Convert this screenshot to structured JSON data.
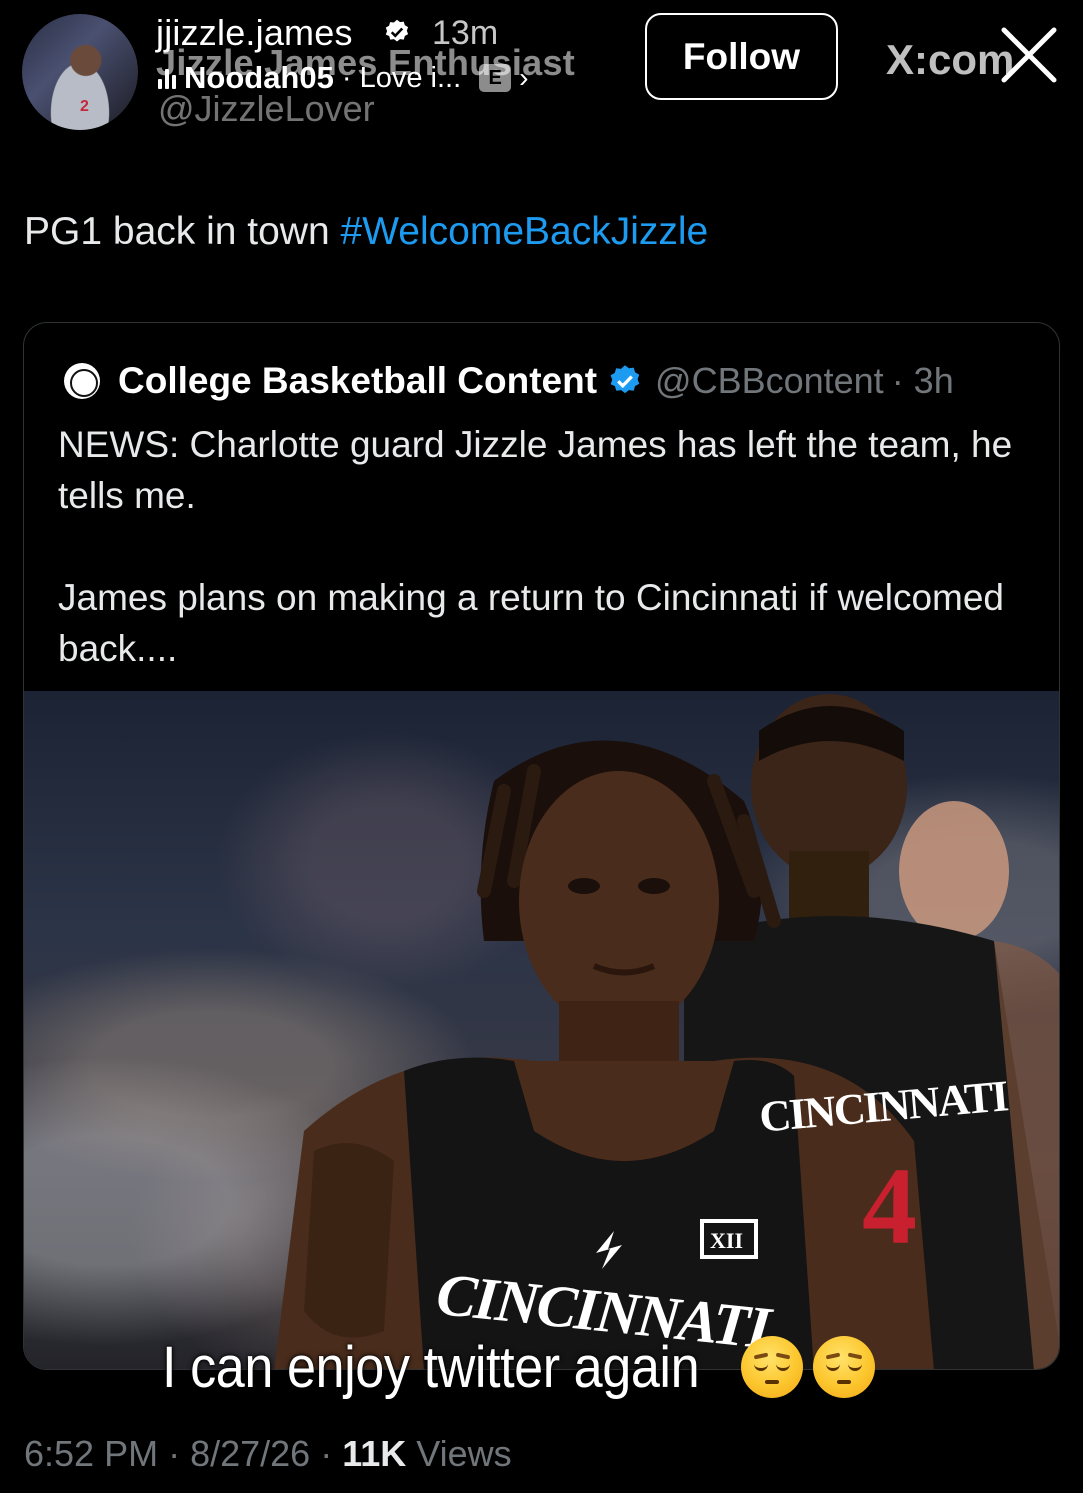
{
  "story": {
    "username": "jjizzle.james",
    "time_ago": "13m",
    "display_name_overlay": "Jizzle James Enthusiast",
    "music": {
      "artist": "Noodah05",
      "track": "· Love i...",
      "badge": "E"
    },
    "follow_label": "Follow",
    "source_label": "X:com"
  },
  "tweet": {
    "handle": "@JizzleLover",
    "text": "PG1 back in town ",
    "hashtag": "#WelcomeBackJizzle",
    "meta": {
      "time": "6:52 PM",
      "date": "8/27/26",
      "views_count": "11K",
      "views_label": " Views"
    }
  },
  "quote": {
    "name": "College Basketball Content",
    "handle": "@CBBcontent",
    "time_ago": "· 3h",
    "paragraph_1": "NEWS: Charlotte guard Jizzle James has left the team, he tells me.",
    "paragraph_2": "James plans on making a return to Cincinnati if welcomed back....",
    "photo": {
      "jersey_text_main": "CINCINNATI",
      "jersey_text_bg": "CINCINNATI",
      "jersey_number_bg": "4"
    }
  },
  "caption": {
    "text": "I can enjoy twitter again"
  },
  "colors": {
    "background": "#000000",
    "hashtag": "#1d9bf0",
    "verified": "#1d9bf0",
    "muted": "#71767b",
    "card_border": "#2f3336"
  },
  "icons": [
    "verified-badge-icon",
    "music-bars-icon",
    "chevron-right-icon",
    "close-icon",
    "emoji-relieved-icon"
  ]
}
